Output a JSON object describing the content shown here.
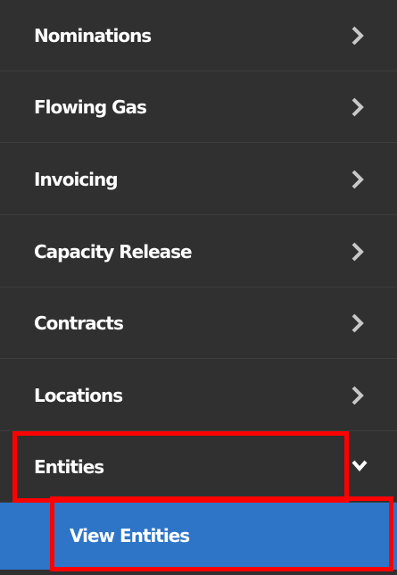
{
  "menu": {
    "items": [
      {
        "label": "Nominations",
        "icon": "chevron-right-icon"
      },
      {
        "label": "Flowing Gas",
        "icon": "chevron-right-icon"
      },
      {
        "label": "Invoicing",
        "icon": "chevron-right-icon"
      },
      {
        "label": "Capacity Release",
        "icon": "chevron-right-icon"
      },
      {
        "label": "Contracts",
        "icon": "chevron-right-icon"
      },
      {
        "label": "Locations",
        "icon": "chevron-right-icon"
      },
      {
        "label": "Entities",
        "icon": "chevron-down-icon",
        "expanded": true
      }
    ],
    "submenu": {
      "label": "View Entities"
    }
  },
  "colors": {
    "menu_background": "#303030",
    "menu_text": "#ffffff",
    "chevron": "#c8c8c8",
    "submenu_background": "#2e75c8",
    "highlight": "#ff0000"
  }
}
